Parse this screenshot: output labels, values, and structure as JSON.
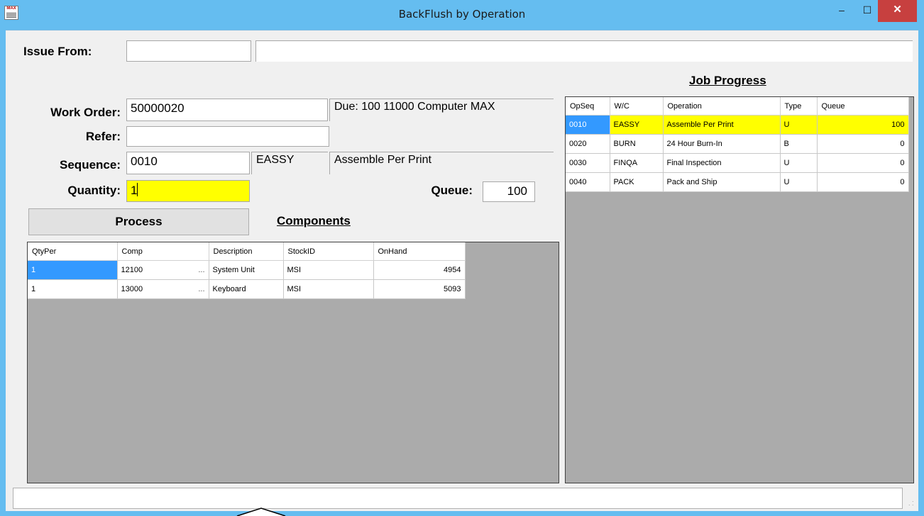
{
  "window": {
    "title": "BackFlush by Operation",
    "icon_text": "MAX",
    "minimize_glyph": "‒",
    "maximize_glyph": "☐",
    "close_glyph": "✕"
  },
  "form": {
    "issue_from_label": "Issue From:",
    "issue_from_value": "",
    "issue_from_desc": "",
    "work_order_label": "Work Order:",
    "work_order_value": "50000020",
    "work_order_desc": "Due: 100 11000 Computer MAX",
    "refer_label": "Refer:",
    "refer_value": "",
    "sequence_label": "Sequence:",
    "sequence_value": "0010",
    "sequence_wc": "EASSY",
    "sequence_desc": "Assemble Per Print",
    "quantity_label": "Quantity:",
    "quantity_value": "1",
    "queue_label": "Queue:",
    "queue_value": "100",
    "process_label": "Process",
    "components_title": "Components",
    "job_progress_title": "Job Progress"
  },
  "components": {
    "columns": [
      "QtyPer",
      "Comp",
      "Description",
      "StockID",
      "OnHand"
    ],
    "rows": [
      {
        "qtyper": "1",
        "comp": "12100",
        "dots": "...",
        "description": "System Unit",
        "stockid": "MSI",
        "onhand": "4954"
      },
      {
        "qtyper": "1",
        "comp": "13000",
        "dots": "...",
        "description": "Keyboard",
        "stockid": "MSI",
        "onhand": "5093"
      }
    ]
  },
  "job_progress": {
    "columns": [
      "OpSeq",
      "W/C",
      "Operation",
      "Type",
      "Queue"
    ],
    "rows": [
      {
        "opseq": "0010",
        "wc": "EASSY",
        "operation": "Assemble Per Print",
        "type": "U",
        "queue": "100"
      },
      {
        "opseq": "0020",
        "wc": "BURN",
        "operation": "24 Hour Burn-In",
        "type": "B",
        "queue": "0"
      },
      {
        "opseq": "0030",
        "wc": "FINQA",
        "operation": "Final Inspection",
        "type": "U",
        "queue": "0"
      },
      {
        "opseq": "0040",
        "wc": "PACK",
        "operation": "Pack and Ship",
        "type": "U",
        "queue": "0"
      }
    ]
  },
  "status_bar": {
    "text": ""
  },
  "colors": {
    "title_bar": "#65bdf0",
    "highlight": "#ffff00",
    "selection": "#3399ff",
    "grid_background": "#ababab",
    "close_button": "#c7403f"
  }
}
